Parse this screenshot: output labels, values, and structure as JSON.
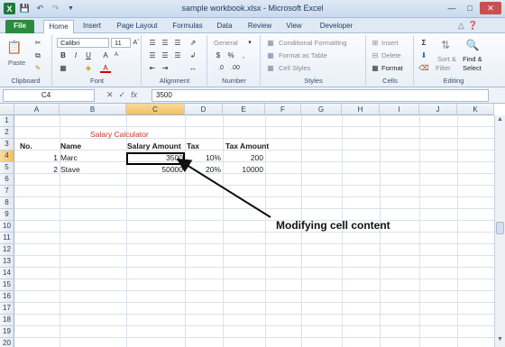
{
  "window": {
    "title": "sample workbook.xlsx - Microsoft Excel"
  },
  "tabs": [
    "File",
    "Home",
    "Insert",
    "Page Layout",
    "Formulas",
    "Data",
    "Review",
    "View",
    "Developer"
  ],
  "ribbon": {
    "clipboard": {
      "paste": "Paste",
      "label": "Clipboard"
    },
    "font": {
      "name": "Calibri",
      "size": "11",
      "label": "Font"
    },
    "alignment": {
      "label": "Alignment"
    },
    "number": {
      "format": "General",
      "label": "Number"
    },
    "styles": {
      "conditional": "Conditional Formatting",
      "table": "Format as Table",
      "cell": "Cell Styles",
      "label": "Styles"
    },
    "cells": {
      "insert": "Insert",
      "delete": "Delete",
      "format": "Format",
      "label": "Cells"
    },
    "editing": {
      "sort": "Sort &",
      "filter": "Filter",
      "find": "Find &",
      "select": "Select",
      "label": "Editing"
    }
  },
  "formula_bar": {
    "name_box": "C4",
    "fx": "fx",
    "value": "3500"
  },
  "columns": [
    "A",
    "B",
    "C",
    "D",
    "E",
    "F",
    "G",
    "H",
    "I",
    "J",
    "K"
  ],
  "rows": [
    "1",
    "2",
    "3",
    "4",
    "5",
    "6",
    "7",
    "8",
    "9",
    "10",
    "11",
    "12",
    "13",
    "14",
    "15",
    "16",
    "17",
    "18",
    "19",
    "20"
  ],
  "sheet": {
    "title": "Salary Calculator",
    "headers": {
      "no": "No.",
      "name": "Name",
      "salary": "Salary Amount",
      "tax": "Tax",
      "tax_amount": "Tax Amount"
    },
    "data": [
      {
        "no": "1",
        "name": "Marc",
        "salary": "3500",
        "tax": "10%",
        "tax_amount": "200"
      },
      {
        "no": "2",
        "name": "Stave",
        "salary": "50000",
        "tax": "20%",
        "tax_amount": "10000"
      }
    ]
  },
  "annotation": "Modifying cell content"
}
